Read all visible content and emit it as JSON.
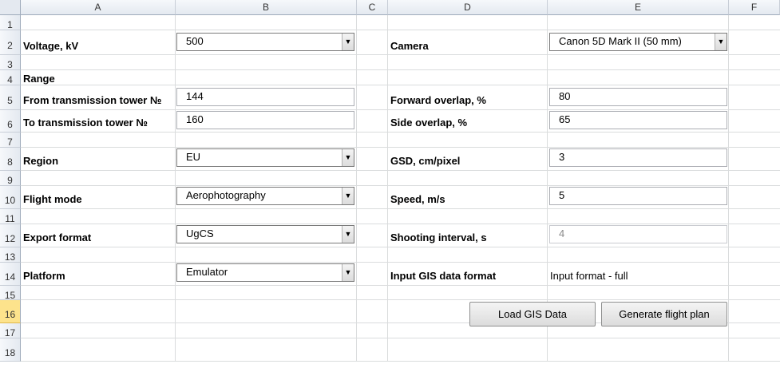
{
  "columns": [
    "A",
    "B",
    "C",
    "D",
    "E",
    "F"
  ],
  "rows": [
    "1",
    "2",
    "3",
    "4",
    "5",
    "6",
    "7",
    "8",
    "9",
    "10",
    "11",
    "12",
    "13",
    "14",
    "15",
    "16",
    "17",
    "18"
  ],
  "form": {
    "voltage_label": "Voltage, kV",
    "voltage_value": "500",
    "range_label": "Range",
    "from_tower_label": "From transmission tower №",
    "from_tower_value": "144",
    "to_tower_label": "To transmission tower №",
    "to_tower_value": "160",
    "region_label": "Region",
    "region_value": "EU",
    "flight_mode_label": "Flight mode",
    "flight_mode_value": "Aerophotography",
    "export_format_label": "Export format",
    "export_format_value": "UgCS",
    "platform_label": "Platform",
    "platform_value": "Emulator",
    "camera_label": "Camera",
    "camera_value": "Canon 5D Mark II (50 mm)",
    "forward_overlap_label": "Forward overlap, %",
    "forward_overlap_value": "80",
    "side_overlap_label": "Side overlap, %",
    "side_overlap_value": "65",
    "gsd_label": "GSD, cm/pixel",
    "gsd_value": "3",
    "speed_label": "Speed, m/s",
    "speed_value": "5",
    "shooting_interval_label": "Shooting interval, s",
    "shooting_interval_value": "4",
    "gis_format_label": "Input GIS data format",
    "gis_format_value": "Input format - full"
  },
  "buttons": {
    "load_gis": "Load GIS Data",
    "generate_plan": "Generate flight plan"
  },
  "dropdown_arrow": "▼",
  "active_row": "16",
  "colors": {
    "active_row_header": "#fde38c",
    "grid_line": "#dadcdd"
  }
}
